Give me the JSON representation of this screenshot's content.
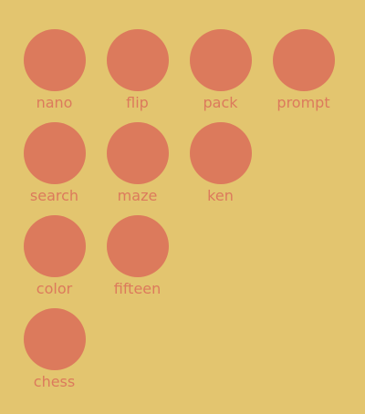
{
  "colors": {
    "background": "#e3c56f",
    "accent": "#dc7a5c"
  },
  "apps": [
    {
      "label": "nano",
      "icon": "nano-app-icon"
    },
    {
      "label": "flip",
      "icon": "flip-app-icon"
    },
    {
      "label": "pack",
      "icon": "pack-app-icon"
    },
    {
      "label": "prompt",
      "icon": "prompt-app-icon"
    },
    {
      "label": "search",
      "icon": "search-app-icon"
    },
    {
      "label": "maze",
      "icon": "maze-app-icon"
    },
    {
      "label": "ken",
      "icon": "ken-app-icon"
    },
    {
      "label": "color",
      "icon": "color-app-icon"
    },
    {
      "label": "fifteen",
      "icon": "fifteen-app-icon"
    },
    {
      "label": "chess",
      "icon": "chess-app-icon"
    }
  ]
}
